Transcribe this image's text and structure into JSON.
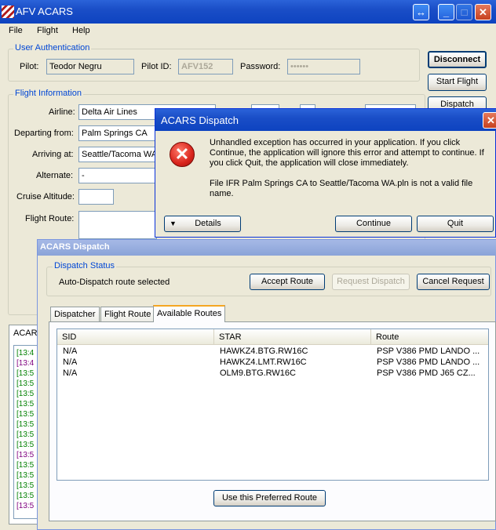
{
  "main": {
    "title": "AFV ACARS",
    "menu": [
      "File",
      "Flight",
      "Help"
    ],
    "auth_group": "User Authentication",
    "pilot_label": "Pilot:",
    "pilot_value": "Teodor Negru",
    "pilotid_label": "Pilot ID:",
    "pilotid_value": "AFV152",
    "password_label": "Password:",
    "password_value": "••••••",
    "disconnect": "Disconnect",
    "start_flight": "Start Flight",
    "dispatch": "Dispatch",
    "flight_group": "Flight Information",
    "airline_label": "Airline:",
    "airline_value": "Delta Air Lines",
    "departing_label": "Departing from:",
    "departing_value": "Palm Springs CA",
    "arriving_label": "Arriving at:",
    "arriving_value": "Seattle/Tacoma WA",
    "alternate_label": "Alternate:",
    "alternate_value": "-",
    "cruise_label": "Cruise Altitude:",
    "route_label": "Flight Route:",
    "acars_tab": "ACAR",
    "log_lines": [
      "[13:4",
      "[13:4",
      "[13:5",
      "[13:5",
      "[13:5",
      "[13:5",
      "[13:5",
      "[13:5",
      "[13:5",
      "[13:5",
      "[13:5",
      "[13:5",
      "[13:5",
      "[13:5",
      "[13:5",
      "[13:5"
    ]
  },
  "error_dialog": {
    "title": "ACARS Dispatch",
    "message1": "Unhandled exception has occurred in your application. If you click Continue, the application will ignore this error and attempt to continue. If you click Quit, the application will close immediately.",
    "message2": "File IFR Palm Springs CA to Seattle/Tacoma WA.pln is not a valid file name.",
    "details": "Details",
    "continue": "Continue",
    "quit": "Quit"
  },
  "dispatch_window": {
    "title": "ACARS Dispatch",
    "status_group": "Dispatch Status",
    "status_text": "Auto-Dispatch route selected",
    "accept_route": "Accept Route",
    "request_dispatch": "Request Dispatch",
    "cancel_request": "Cancel Request",
    "tabs": [
      "Dispatcher",
      "Flight Route",
      "Available Routes"
    ],
    "columns": [
      "SID",
      "STAR",
      "Route"
    ],
    "rows": [
      {
        "sid": "N/A",
        "star": "HAWKZ4.BTG.RW16C",
        "route": "PSP V386 PMD LANDO ..."
      },
      {
        "sid": "N/A",
        "star": "HAWKZ4.LMT.RW16C",
        "route": "PSP V386 PMD LANDO ..."
      },
      {
        "sid": "N/A",
        "star": "OLM9.BTG.RW16C",
        "route": "PSP V386 PMD J65 CZ..."
      }
    ],
    "use_preferred": "Use this Preferred Route"
  },
  "colors": {
    "title_blue": "#0d43c0",
    "group_title": "#0046d5",
    "log_green": "#008000",
    "log_purple": "#800080",
    "error_red": "#d9251d"
  }
}
